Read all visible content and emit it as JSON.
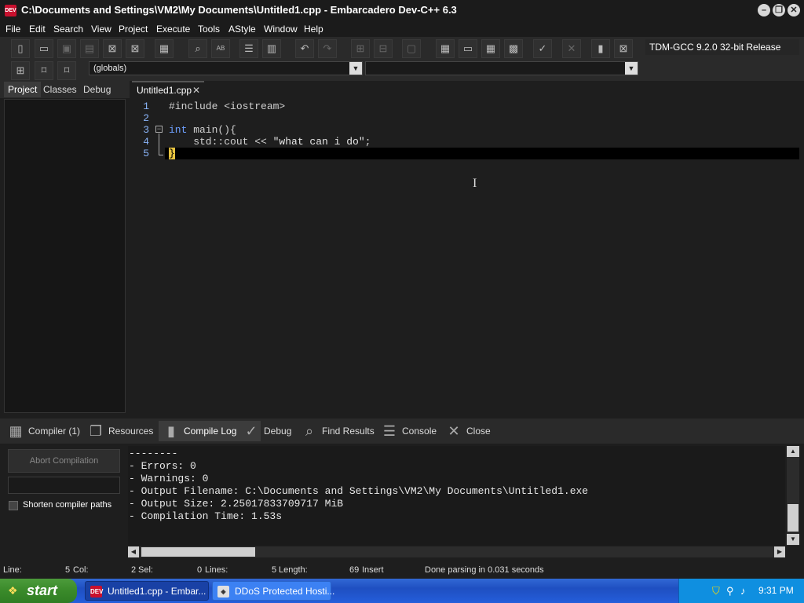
{
  "window": {
    "title": "C:\\Documents and Settings\\VM2\\My Documents\\Untitled1.cpp - Embarcadero Dev-C++ 6.3",
    "icon_text": "DEV\nC++"
  },
  "menu": [
    "File",
    "Edit",
    "Search",
    "View",
    "Project",
    "Execute",
    "Tools",
    "AStyle",
    "Window",
    "Help"
  ],
  "toolbar": {
    "compiler": "TDM-GCC 9.2.0 32-bit Release",
    "globals": "(globals)"
  },
  "left_tabs": [
    "Project",
    "Classes",
    "Debug"
  ],
  "editor": {
    "tab_label": "Untitled1.cpp",
    "line_numbers": [
      "1",
      "2",
      "3",
      "4",
      "5"
    ],
    "lines": {
      "l1": "#include <iostream>",
      "l3_kw": "int",
      "l3_rest": " main(){",
      "l4_pre": "    std::cout << ",
      "l4_str": "\"what can i do\"",
      "l4_end": ";",
      "l5": "}"
    }
  },
  "bottom_tabs": [
    "Compiler (1)",
    "Resources",
    "Compile Log",
    "Debug",
    "Find Results",
    "Console",
    "Close"
  ],
  "compile_panel": {
    "abort_label": "Abort Compilation",
    "shorten_label": "Shorten compiler paths",
    "log": [
      "--------",
      "- Errors: 0",
      "- Warnings: 0",
      "- Output Filename: C:\\Documents and Settings\\VM2\\My Documents\\Untitled1.exe",
      "- Output Size: 2.25017833709717 MiB",
      "- Compilation Time: 1.53s"
    ]
  },
  "status": {
    "line_label": "Line:",
    "line_val": "5",
    "col_label": "Col:",
    "col_val": "2",
    "sel_label": "Sel:",
    "sel_val": "0",
    "lines_label": "Lines:",
    "lines_val": "5",
    "length_label": "Length:",
    "length_val": "69",
    "mode": "Insert",
    "message": "Done parsing in 0.031 seconds"
  },
  "taskbar": {
    "start": "start",
    "tasks": [
      "Untitled1.cpp - Embar...",
      "DDoS Protected Hosti..."
    ],
    "clock": "9:31 PM"
  },
  "colors": {
    "editor_bg": "#1e1e1e",
    "keyword": "#6ea0ff",
    "taskbar": "#245edb",
    "start": "#3a8a2a"
  }
}
